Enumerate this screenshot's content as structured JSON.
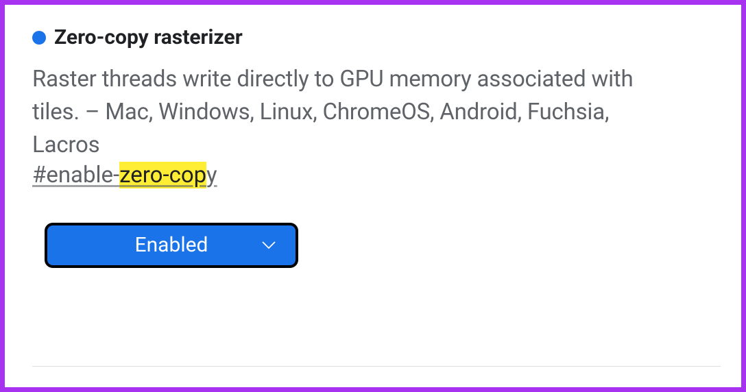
{
  "flag": {
    "title": "Zero-copy rasterizer",
    "description": "Raster threads write directly to GPU memory associated with tiles. – Mac, Windows, Linux, ChromeOS, Android, Fuchsia, Lacros",
    "anchor_prefix": "#enable-",
    "anchor_highlight": "zero-cop",
    "anchor_suffix": "y",
    "status_color": "#1a73e8"
  },
  "dropdown": {
    "selected": "Enabled"
  }
}
